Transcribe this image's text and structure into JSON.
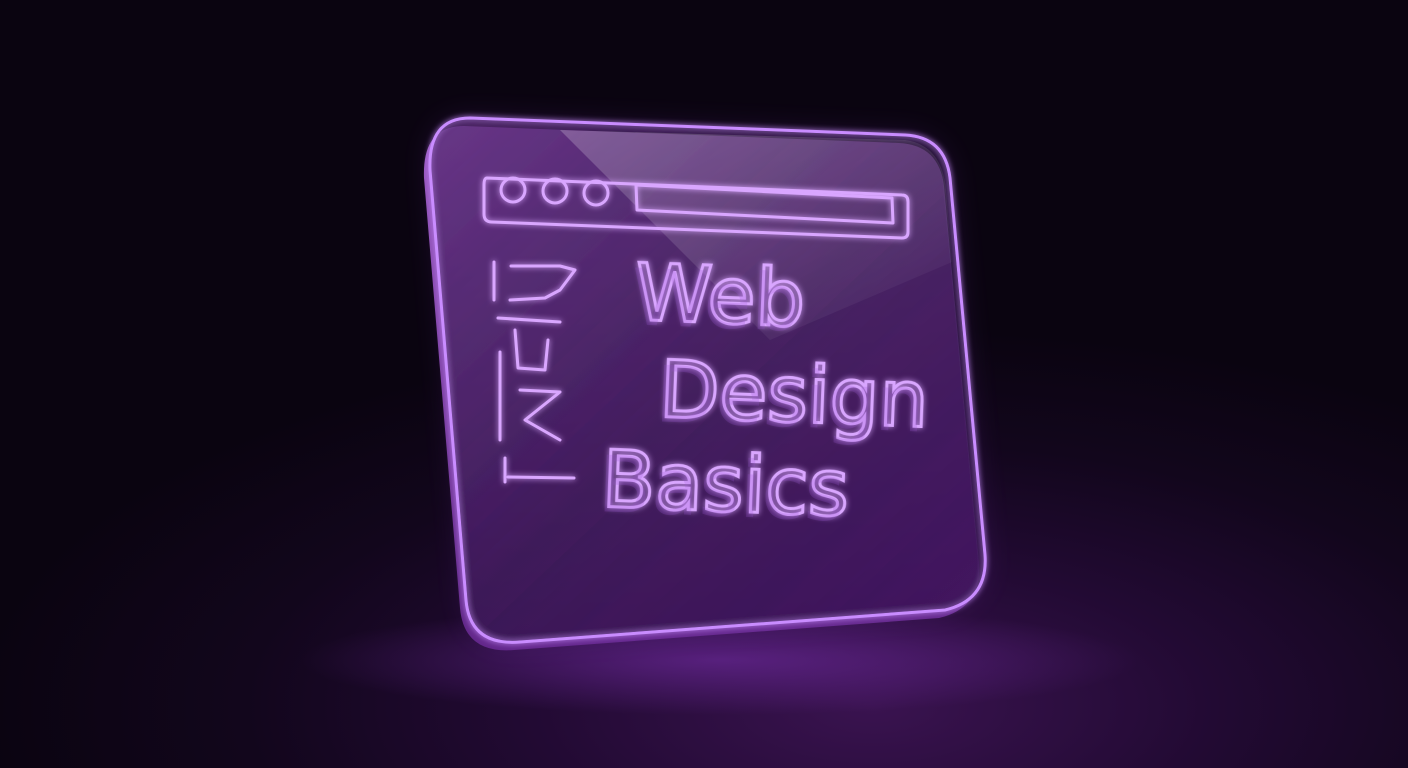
{
  "graphic": {
    "title_lines": [
      "Web",
      "Design",
      "Basics"
    ],
    "window_dots": 3,
    "accent_color": "#c98cff",
    "glow_color": "#a040ff",
    "background_color": "#12061c"
  }
}
